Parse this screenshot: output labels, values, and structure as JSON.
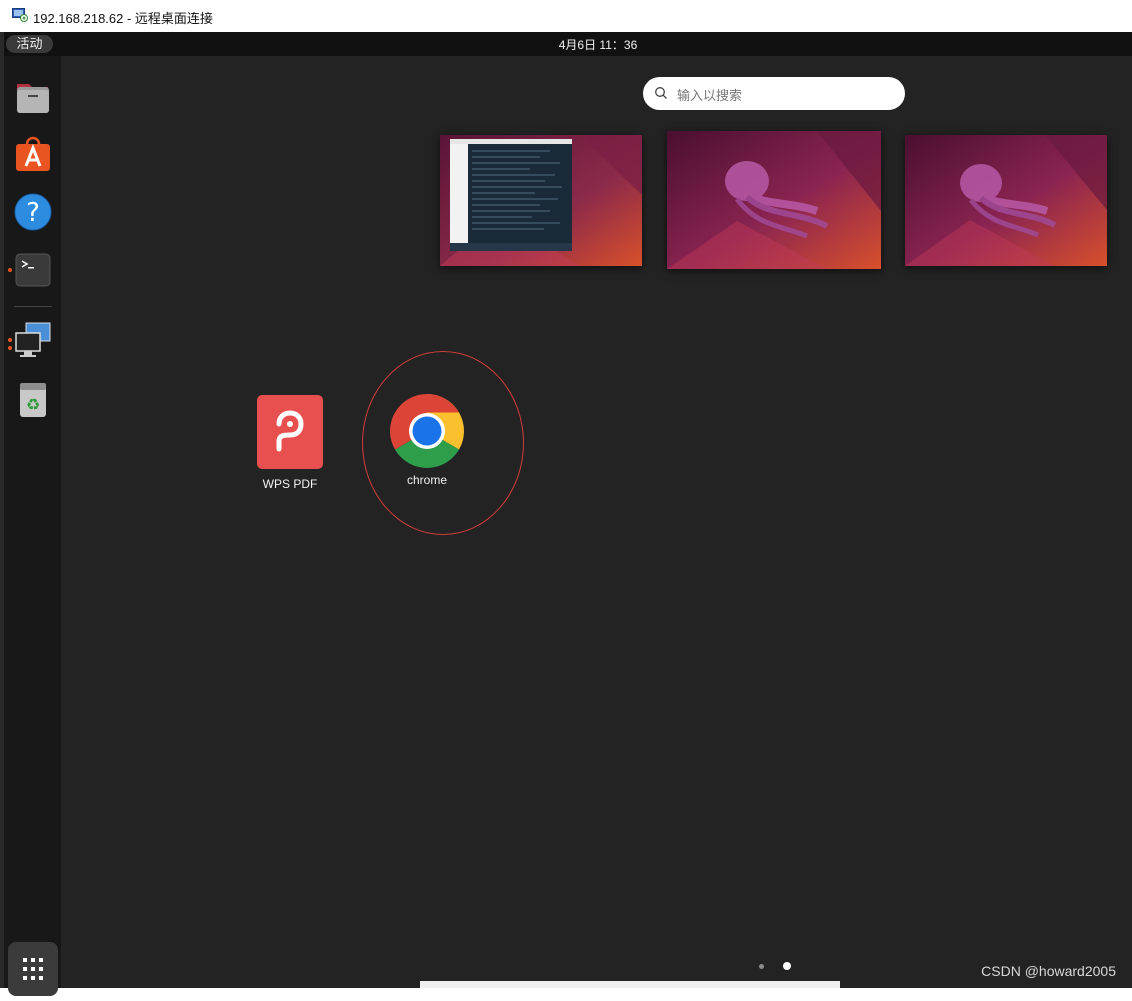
{
  "window": {
    "title": "192.168.218.62 - 远程桌面连接",
    "icon": "remote-desktop-icon"
  },
  "topbar": {
    "activities": "活动",
    "clock": "4月6日  11：36"
  },
  "dock": {
    "items": [
      {
        "name": "files",
        "icon": "folder-icon"
      },
      {
        "name": "software",
        "icon": "app-store-icon"
      },
      {
        "name": "help",
        "icon": "help-icon"
      },
      {
        "name": "terminal",
        "icon": "terminal-icon",
        "running": true
      },
      {
        "name": "remote-desktop",
        "icon": "monitors-icon",
        "running": true
      },
      {
        "name": "trash",
        "icon": "trash-icon"
      }
    ],
    "show_apps": "grid-icon"
  },
  "search": {
    "placeholder": "输入以搜索"
  },
  "apps": [
    {
      "label": "WPS PDF",
      "icon": "wps-pdf-icon"
    },
    {
      "label": "chrome",
      "icon": "chrome-icon"
    }
  ],
  "pages": {
    "count": 2,
    "current": 2
  },
  "watermark": "CSDN @howard2005",
  "colors": {
    "accent": "#e95420",
    "highlight": "#d23c3c",
    "background": "#232323"
  }
}
